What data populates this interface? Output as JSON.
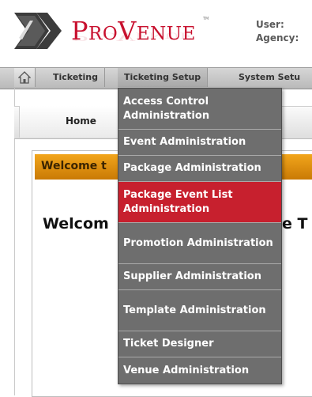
{
  "header": {
    "logo_text_big1": "P",
    "logo_text_small1": "RO",
    "logo_text_big2": "V",
    "logo_text_small2": "ENUE",
    "user_label": "User:",
    "agency_label": "Agency:"
  },
  "nav": {
    "home_icon": "home-icon",
    "items": [
      {
        "label": "Ticketing"
      },
      {
        "label": "Ticketing Setup"
      },
      {
        "label": "System Setu"
      }
    ]
  },
  "tabs": {
    "home": "Home"
  },
  "welcome": {
    "bar_text": "Welcome t",
    "big_left": "Welcom",
    "big_right": "e T"
  },
  "dropdown": {
    "items": [
      {
        "label": "Access Control Administration"
      },
      {
        "label": "Event Administration"
      },
      {
        "label": "Package Administration"
      },
      {
        "label": "Package Event List Administration",
        "highlighted": true
      },
      {
        "label": "Promotion Administration"
      },
      {
        "label": "Supplier Administration"
      },
      {
        "label": "Template Administration"
      },
      {
        "label": "Ticket Designer"
      },
      {
        "label": "Venue Administration"
      }
    ]
  },
  "colors": {
    "brand_red": "#c8102e",
    "menu_bg": "#6e6e6e",
    "menu_highlight": "#c7202e",
    "welcome_orange": "#e59614"
  }
}
